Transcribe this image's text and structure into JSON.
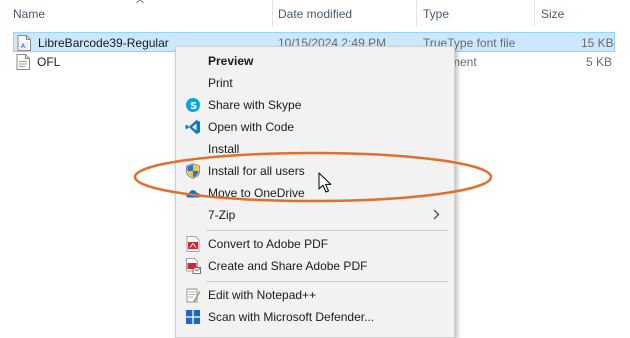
{
  "columns": {
    "name": "Name",
    "date_modified": "Date modified",
    "type": "Type",
    "size": "Size"
  },
  "files": [
    {
      "name": "LibreBarcode39-Regular",
      "date": "10/15/2024 2:49 PM",
      "type": "TrueType font file",
      "size": "15 KB",
      "selected": true,
      "icon": "font-file-icon"
    },
    {
      "name": "OFL",
      "type": "Document",
      "size": "5 KB",
      "selected": false,
      "icon": "text-file-icon"
    }
  ],
  "context_menu": {
    "preview": "Preview",
    "print": "Print",
    "share_skype": "Share with Skype",
    "open_code": "Open with Code",
    "install": "Install",
    "install_all": "Install for all users",
    "move_onedrive": "Move to OneDrive",
    "seven_zip": "7-Zip",
    "convert_pdf": "Convert to Adobe PDF",
    "create_share_pdf": "Create and Share Adobe PDF",
    "notepadpp": "Edit with Notepad++",
    "defender": "Scan with Microsoft Defender..."
  },
  "colors": {
    "selection_bg": "#cce8ff",
    "menu_bg": "#f2f2f2",
    "annotation": "#e0702a"
  }
}
